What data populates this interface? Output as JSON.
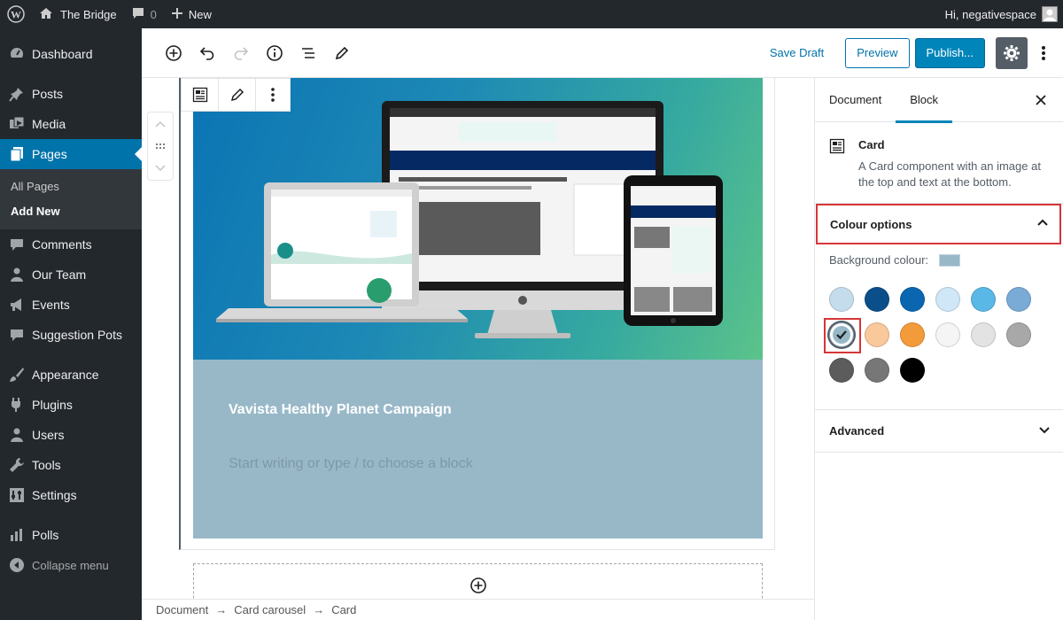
{
  "adminbar": {
    "site_name": "The Bridge",
    "comments_count": "0",
    "new_label": "New",
    "greeting": "Hi, negativespace"
  },
  "sidebar": {
    "items": [
      {
        "label": "Dashboard",
        "icon": "dashboard-icon"
      },
      {
        "label": "Posts",
        "icon": "pin-icon"
      },
      {
        "label": "Media",
        "icon": "media-icon"
      },
      {
        "label": "Pages",
        "icon": "pages-icon"
      },
      {
        "label": "Comments",
        "icon": "comments-icon"
      },
      {
        "label": "Our Team",
        "icon": "user-icon"
      },
      {
        "label": "Events",
        "icon": "megaphone-icon"
      },
      {
        "label": "Suggestion Pots",
        "icon": "comments-icon"
      },
      {
        "label": "Appearance",
        "icon": "brush-icon"
      },
      {
        "label": "Plugins",
        "icon": "plugin-icon"
      },
      {
        "label": "Users",
        "icon": "user-icon"
      },
      {
        "label": "Tools",
        "icon": "wrench-icon"
      },
      {
        "label": "Settings",
        "icon": "settings-icon"
      },
      {
        "label": "Polls",
        "icon": "chart-icon"
      }
    ],
    "submenu": [
      "All Pages",
      "Add New"
    ],
    "collapse_label": "Collapse menu"
  },
  "toolbar": {
    "save_draft": "Save Draft",
    "preview": "Preview",
    "publish": "Publish..."
  },
  "card": {
    "title": "Vavista Healthy Planet Campaign",
    "placeholder": "Start writing or type / to choose a block"
  },
  "breadcrumb": [
    "Document",
    "Card carousel",
    "Card"
  ],
  "panel": {
    "tabs": [
      "Document",
      "Block"
    ],
    "block_name": "Card",
    "block_desc": "A Card component with an image at the top and text at the bottom.",
    "colour_options": "Colour options",
    "background_label": "Background colour:",
    "advanced": "Advanced",
    "swatches": [
      "#c5dcec",
      "#0a4f8a",
      "#0a66b0",
      "#cfe7f7",
      "#5ab8e6",
      "#7aaad6",
      "#98b8c8",
      "#f9c89b",
      "#f39a3a",
      "#f5f5f5",
      "#e3e3e3",
      "#a8a8a8",
      "#5c5c5c",
      "#777777",
      "#000000"
    ],
    "selected_colour": "#98b8c8"
  },
  "colors": {
    "accent": "#0073aa",
    "admin_dark": "#23282d",
    "highlight_red": "#d63638"
  }
}
